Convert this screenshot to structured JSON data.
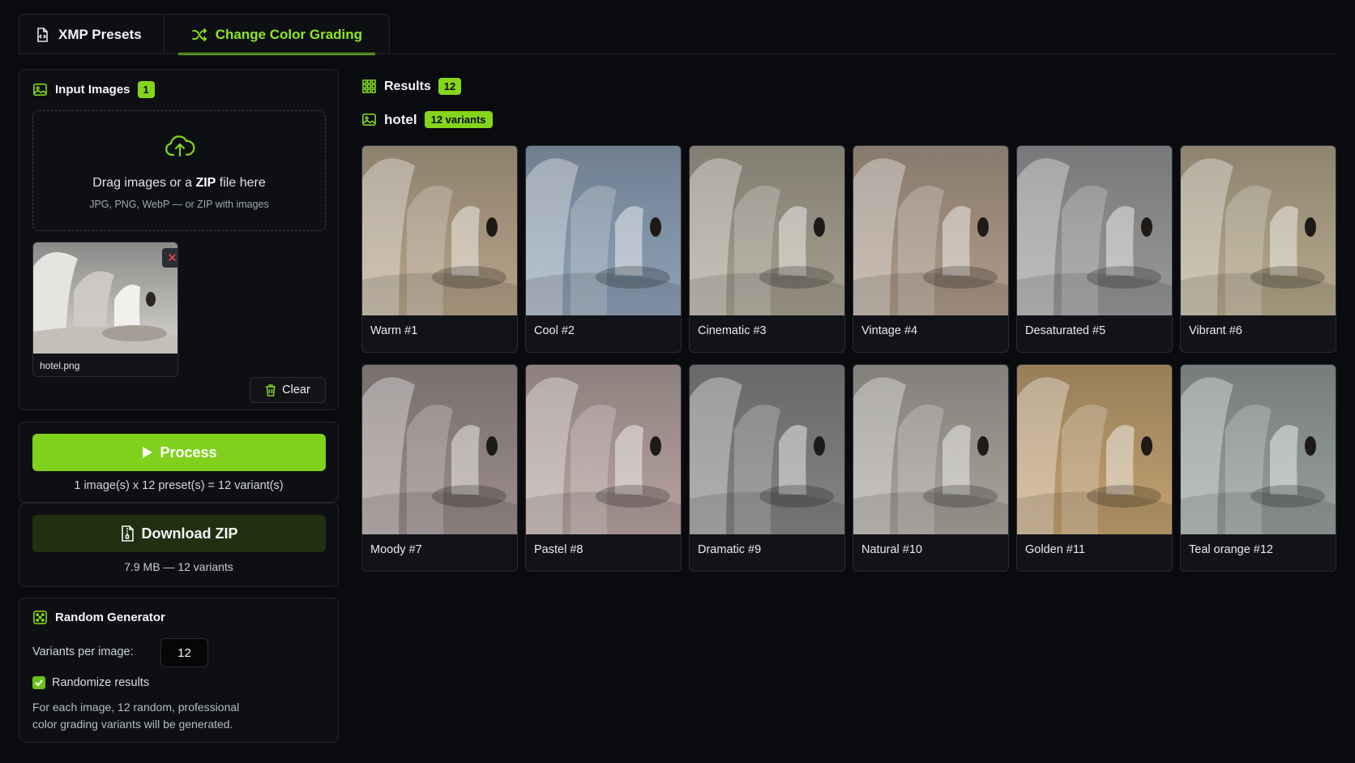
{
  "tabs": [
    {
      "label": "XMP Presets",
      "icon": "file-code-icon",
      "active": false
    },
    {
      "label": "Change Color Grading",
      "icon": "shuffle-icon",
      "active": true
    }
  ],
  "input_panel": {
    "title": "Input Images",
    "count": "1",
    "dropzone": {
      "main_prefix": "Drag images or a ",
      "main_bold": "ZIP",
      "main_suffix": " file here",
      "sub": "JPG, PNG, WebP — or ZIP with images"
    },
    "files": [
      {
        "name": "hotel.png"
      }
    ],
    "clear_label": "Clear"
  },
  "process_panel": {
    "button_label": "Process",
    "summary": "1 image(s) x 12 preset(s) = 12 variant(s)"
  },
  "download_panel": {
    "button_label": "Download ZIP",
    "summary": "7.9 MB — 12 variants"
  },
  "random_panel": {
    "title": "Random Generator",
    "variants_label": "Variants per image:",
    "variants_value": "12",
    "randomize_label": "Randomize results",
    "randomize_checked": true,
    "description": "For each image, 12 random, professional color grading variants will be generated."
  },
  "results": {
    "title": "Results",
    "count": "12",
    "group_name": "hotel",
    "group_badge": "12 variants",
    "variants": [
      {
        "label": "Warm #1",
        "tint": "#b8a58a"
      },
      {
        "label": "Cool #2",
        "tint": "#8fa3b8"
      },
      {
        "label": "Cinematic #3",
        "tint": "#a8a190"
      },
      {
        "label": "Vintage #4",
        "tint": "#b09c8a"
      },
      {
        "label": "Desaturated #5",
        "tint": "#9a9a9a"
      },
      {
        "label": "Vibrant #6",
        "tint": "#b8aa8c"
      },
      {
        "label": "Moody #7",
        "tint": "#9c8e8c"
      },
      {
        "label": "Pastel #8",
        "tint": "#b8a4a0"
      },
      {
        "label": "Dramatic #9",
        "tint": "#858585"
      },
      {
        "label": "Natural #10",
        "tint": "#a9a49c"
      },
      {
        "label": "Golden #11",
        "tint": "#c4a270"
      },
      {
        "label": "Teal orange #12",
        "tint": "#98a09c"
      }
    ]
  },
  "colors": {
    "accent": "#84d61a",
    "background": "#0a0b0f",
    "panel": "#0d0f13",
    "danger": "#ff4b4b"
  }
}
